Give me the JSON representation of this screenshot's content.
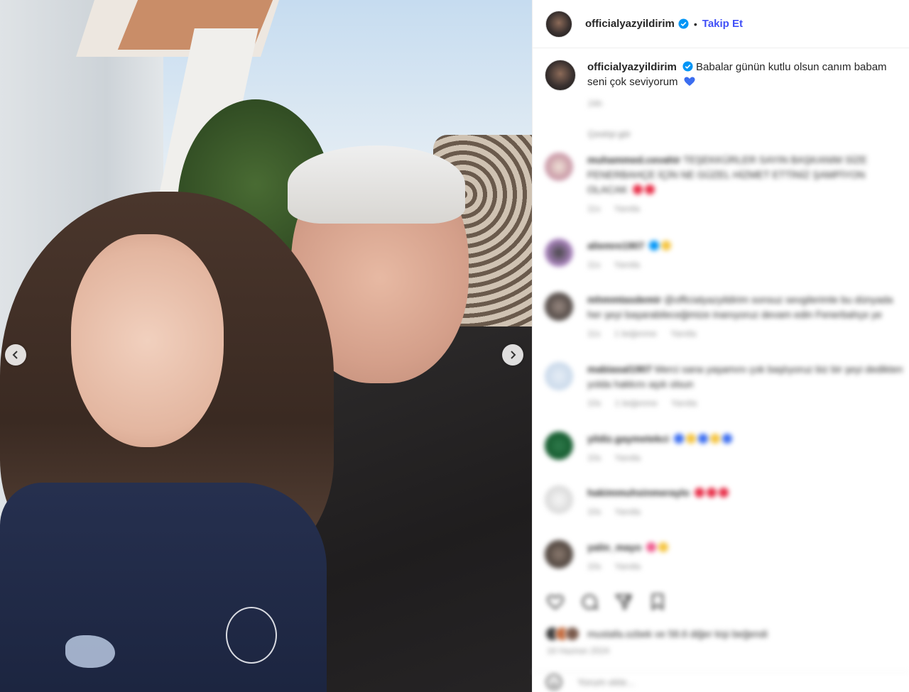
{
  "post": {
    "username": "officialyazyildirim",
    "dot": "•",
    "follow_label": "Takip Et",
    "caption": "Babalar günün kutlu olsun canım babam seni çok seviyorum",
    "caption_time": "24h",
    "see_translation": "Çeviriyi gör"
  },
  "comments": [
    {
      "user": "muhammed.cevahir",
      "text": "TEŞEKKÜRLER SAYIN BAŞKANIM SİZE FENERBAHÇE İÇİN NE GÜZEL HİZMET ETTİNİZ ŞAMPİYON OLACAK",
      "time": "11s",
      "reply": "Yanıtla"
    },
    {
      "user": "aliemre1907",
      "text": "",
      "time": "11s",
      "reply": "Yanıtla"
    },
    {
      "user": "mhmmtasdemir",
      "text": "@officialyazyildirim sonsuz sevgilerimle bu dünyada her şeyi başarabileceğimize inanıyoruz devam edin Fenerbahçe ye",
      "time": "11s",
      "likes": "1 beğenme",
      "reply": "Yanıtla"
    },
    {
      "user": "mabiasal1907",
      "text": "Merci sana yaşamını çok başlıyoruz biz bir şeyi dedikten yolda hakkını aşık olsun",
      "time": "10s",
      "likes": "1 beğenme",
      "reply": "Yanıtla"
    },
    {
      "user": "yildiz.gaymetekci",
      "text": "",
      "time": "10s",
      "reply": "Yanıtla"
    },
    {
      "user": "hakimmuhsinmeraylo",
      "text": "",
      "time": "10s",
      "reply": "Yanıtla"
    },
    {
      "user": "yalin_mayo",
      "text": "",
      "time": "10s",
      "reply": "Yanıtla"
    }
  ],
  "likes_text": "mustafa.ozbek ve 58.6 diğer kişi beğendi",
  "date_text": "16 Haziran 2024",
  "add_comment_placeholder": "Yorum ekle...",
  "colors": {
    "accent": "#4150f7",
    "verified": "#0095f6",
    "heart_blue": "#3b6df0",
    "heart_red": "#e8304a"
  }
}
